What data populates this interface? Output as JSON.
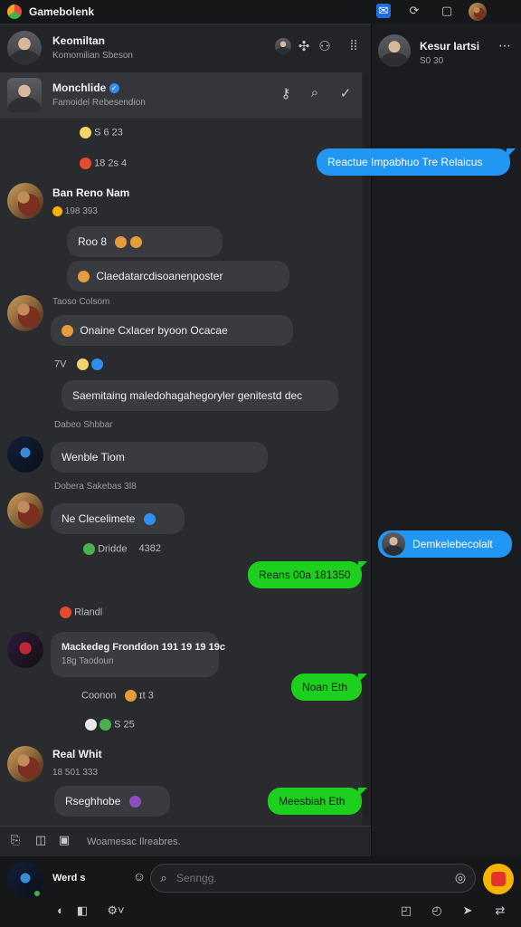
{
  "titlebar": {
    "title": "Gamebolenk"
  },
  "contact_top": {
    "name": "Keomiltan",
    "status": "Komomilian Sbeson"
  },
  "active_chat": {
    "name": "Monchlide",
    "status": "Famoidel Rebesendion"
  },
  "right_panel": {
    "contact": {
      "name": "Kesur Iartsi",
      "status": "S0 30"
    },
    "mini_pill": "Demkelebecolalt"
  },
  "messages": {
    "react1": "S  6  23",
    "react2": "18  2s  4",
    "out_blue_1": "Reactue Impabhuo  Tre Relaicus",
    "sender1": {
      "name": "Ban Reno Nam",
      "meta": "198 393"
    },
    "bubble1": "Roo  8",
    "bubble2": "Claedatarcdisoanenposter",
    "sender2": {
      "name": "Taoso Colsom"
    },
    "bubble3": "Onaine Cxlacer byoon Ocacae",
    "react3": "7V",
    "bubble4": "Saemitaing maledohagahegoryler genitestd dec",
    "sender3": {
      "name": "Dabeo Shbbar"
    },
    "bubble5": "Wenble Tiom",
    "sender4": {
      "name": "Dobera Sakebas",
      "meta": "3l8"
    },
    "bubble6": "Ne Clecelimete",
    "react4": "Dridde",
    "react4_suffix": "4382",
    "out_green_1": "Reans 00a 181350",
    "react5": "Rlandl",
    "sender5": {
      "name": "Mackedeg Fronddon 191 19 19 19c",
      "meta": "18g Taodoun"
    },
    "out_green_2": "Noan Eth",
    "react6": "Coonon",
    "react6_suffix": "ɪt  3",
    "react7": "S  25",
    "sender6": {
      "name": "Real Whit",
      "meta": "18 501 333"
    },
    "bubble7": "Rseghhobe",
    "out_green_3": "Meesbiah Eth"
  },
  "composer": {
    "hint": "Woamesac Ilreabres."
  },
  "bottom": {
    "user": "Werd s",
    "search_placeholder": "Senngg."
  },
  "colors": {
    "accent_blue": "#2196f3",
    "accent_green": "#1ed01e",
    "bg": "#2a2b2f"
  }
}
